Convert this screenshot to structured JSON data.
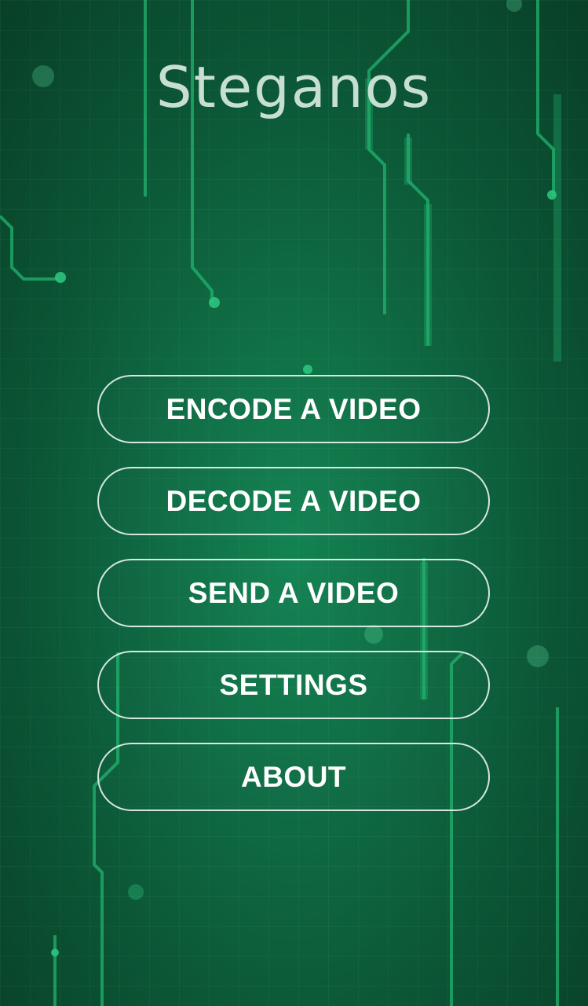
{
  "app": {
    "title": "Steganos"
  },
  "menu": {
    "items": [
      {
        "label": "ENCODE A VIDEO"
      },
      {
        "label": "DECODE A VIDEO"
      },
      {
        "label": "SEND A VIDEO"
      },
      {
        "label": "SETTINGS"
      },
      {
        "label": "ABOUT"
      }
    ]
  },
  "colors": {
    "background": "#0f6a42",
    "circuit": "#22b36f",
    "button_border": "#ebf5f0",
    "text": "#ffffff",
    "title": "#c7dfd2"
  }
}
